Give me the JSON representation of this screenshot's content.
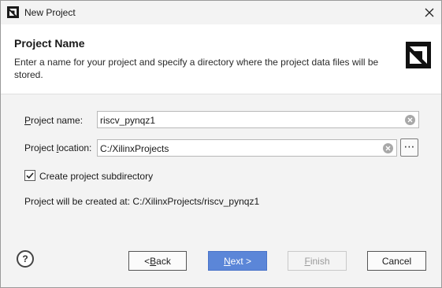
{
  "window": {
    "title": "New Project",
    "app_icon": "amd-logo-icon",
    "close_icon": "close-icon"
  },
  "header": {
    "title": "Project Name",
    "description": "Enter a name for your project and specify a directory where the project data files will be stored.",
    "logo": "amd-logo-icon"
  },
  "form": {
    "project_name": {
      "label_mnemonic": "P",
      "label_rest": "roject name:",
      "value": "riscv_pynqz1",
      "clear_icon": "clear-icon"
    },
    "project_location": {
      "label_prefix": "Project ",
      "label_mnemonic": "l",
      "label_rest": "ocation:",
      "value": "C:/XilinxProjects",
      "clear_icon": "clear-icon",
      "browse_icon": "ellipsis-icon",
      "browse_label": "⋯"
    },
    "create_subdir": {
      "label": "Create project subdirectory",
      "checked": true
    },
    "info": "Project will be created at: C:/XilinxProjects/riscv_pynqz1"
  },
  "footer": {
    "help_label": "?",
    "back": {
      "prefix": "< ",
      "mnemonic": "B",
      "rest": "ack"
    },
    "next": {
      "mnemonic": "N",
      "rest": "ext >"
    },
    "finish": {
      "mnemonic": "F",
      "rest": "inish"
    },
    "cancel": {
      "label": "Cancel"
    }
  },
  "colors": {
    "accent": "#5b86d8",
    "header_bg": "#ffffff",
    "window_bg": "#f3f3f3"
  }
}
